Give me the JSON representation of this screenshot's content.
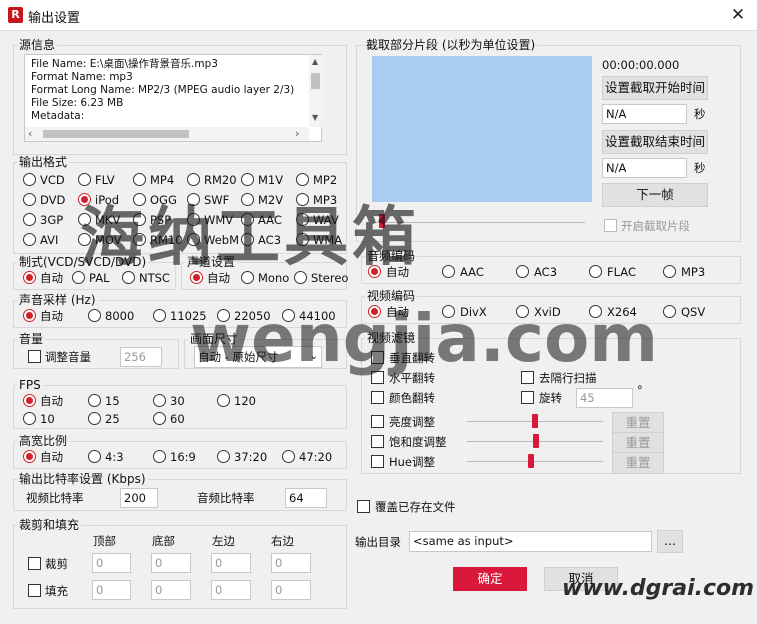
{
  "window": {
    "title": "输出设置",
    "app_icon": "R"
  },
  "source": {
    "title": "源信息",
    "lines": [
      "File Name: E:\\桌面\\操作背景音乐.mp3",
      "Format Name: mp3",
      "Format Long Name: MP2/3 (MPEG audio layer 2/3)",
      "File Size: 6.23 MB",
      "Metadata:"
    ]
  },
  "output_format": {
    "title": "输出格式",
    "options": [
      "VCD",
      "FLV",
      "MP4",
      "RM20",
      "M1V",
      "MP2",
      "DVD",
      "iPod",
      "OGG",
      "SWF",
      "M2V",
      "MP3",
      "3GP",
      "MKV",
      "PSP",
      "WMV",
      "AAC",
      "WAV",
      "AVI",
      "MOV",
      "RM10",
      "WebM",
      "AC3",
      "WMA"
    ],
    "selected": "iPod"
  },
  "standard": {
    "title": "制式(VCD/SVCD/DVD)",
    "options": [
      "自动",
      "PAL",
      "NTSC"
    ],
    "selected": "自动"
  },
  "channel": {
    "title": "声道设置",
    "options": [
      "自动",
      "Mono",
      "Stereo"
    ],
    "selected": "自动"
  },
  "sample_rate": {
    "title": "声音采样 (Hz)",
    "options": [
      "自动",
      "8000",
      "11025",
      "22050",
      "44100"
    ],
    "selected": "自动"
  },
  "volume": {
    "title": "音量",
    "check_label": "调整音量",
    "value": "256"
  },
  "frame_size": {
    "title": "画面尺寸",
    "value": "自动 - 原始尺寸"
  },
  "fps": {
    "title": "FPS",
    "options": [
      "自动",
      "15",
      "30",
      "120",
      "10",
      "25",
      "60"
    ],
    "selected": "自动"
  },
  "aspect": {
    "title": "高宽比例",
    "options": [
      "自动",
      "4:3",
      "16:9",
      "37:20",
      "47:20"
    ],
    "selected": "自动"
  },
  "bitrate": {
    "title": "输出比特率设置 (Kbps)",
    "video_label": "视频比特率",
    "video_value": "200",
    "audio_label": "音频比特率",
    "audio_value": "64"
  },
  "crop": {
    "title": "裁剪和填充",
    "headers": [
      "顶部",
      "底部",
      "左边",
      "右边"
    ],
    "rows": [
      {
        "label": "裁剪",
        "values": [
          "0",
          "0",
          "0",
          "0"
        ]
      },
      {
        "label": "填充",
        "values": [
          "0",
          "0",
          "0",
          "0"
        ]
      }
    ]
  },
  "clip": {
    "title": "截取部分片段 (以秒为单位设置)",
    "time": "00:00:00.000",
    "set_start": "设置截取开始时间",
    "start_value": "N/A",
    "set_end": "设置截取结束时间",
    "end_value": "N/A",
    "unit": "秒",
    "next_frame": "下一帧",
    "enable_label": "开启截取片段"
  },
  "audio_codec": {
    "title": "音频编码",
    "options": [
      "自动",
      "AAC",
      "AC3",
      "FLAC",
      "MP3"
    ],
    "selected": "自动"
  },
  "video_codec": {
    "title": "视频编码",
    "options": [
      "自动",
      "DivX",
      "XviD",
      "X264",
      "QSV"
    ],
    "selected": "自动"
  },
  "filter": {
    "title": "视频滤镜",
    "flip_v": "垂直翻转",
    "flip_h": "水平翻转",
    "deinterlace": "去隔行扫描",
    "color_flip": "颜色翻转",
    "rotate": "旋转",
    "rotate_value": "45",
    "degree": "°",
    "brightness": "亮度调整",
    "saturation": "饱和度调整",
    "hue": "Hue调整",
    "brightness_level": 0.5,
    "saturation_level": 0.51,
    "hue_level": 0.47,
    "reset": "重置"
  },
  "overwrite_label": "覆盖已存在文件",
  "output_dir": {
    "label": "输出目录",
    "value": "<same as input>",
    "browse": "..."
  },
  "actions": {
    "ok": "确定",
    "cancel": "取消"
  },
  "watermarks": {
    "main": "海纳工具箱",
    "sub": "wengjia.com",
    "corner": "www.dgrai.com"
  },
  "colors": {
    "accent": "#d9183b",
    "preview": "#aaccf0"
  }
}
